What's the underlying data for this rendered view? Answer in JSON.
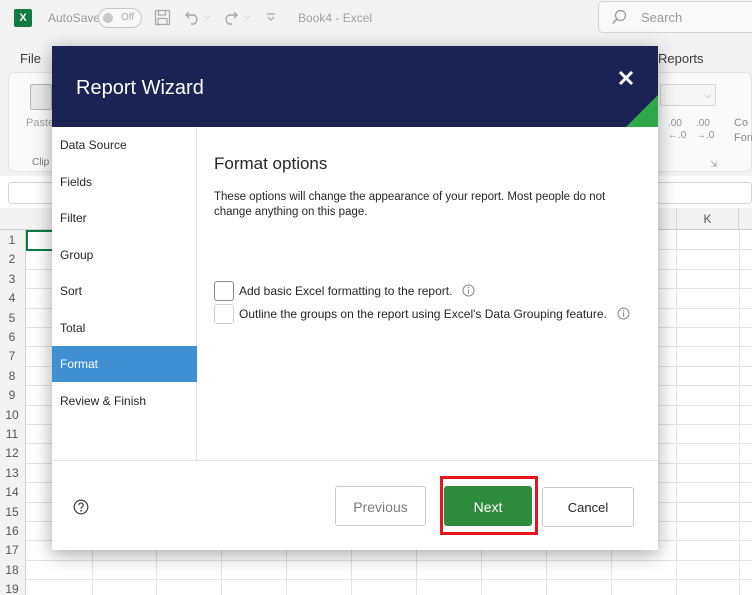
{
  "excel": {
    "logo_letter": "X",
    "autosave_label": "AutoSave",
    "autosave_state": "Off",
    "doc_title": "Book4  -  Excel",
    "search_placeholder": "Search",
    "menu": {
      "file": "File",
      "reports": "Reports"
    },
    "ribbon": {
      "paste_label": "Paste",
      "clipboard_label": "Clip",
      "increase_decimal": ".00",
      "decrease_decimal": ".00",
      "increase_decimal_sub": "←.0",
      "decrease_decimal_sub": "→.0",
      "cond_format_line1": "Co",
      "cond_format_line2": "Forr"
    },
    "grid": {
      "visible_column": "K",
      "rows": [
        "1",
        "2",
        "3",
        "4",
        "5",
        "6",
        "7",
        "8",
        "9",
        "10",
        "11",
        "12",
        "13",
        "14",
        "15",
        "16",
        "17",
        "18",
        "19"
      ]
    }
  },
  "dialog": {
    "title": "Report Wizard",
    "nav_items": [
      {
        "label": "Data Source",
        "active": false
      },
      {
        "label": "Fields",
        "active": false
      },
      {
        "label": "Filter",
        "active": false
      },
      {
        "label": "Group",
        "active": false
      },
      {
        "label": "Sort",
        "active": false
      },
      {
        "label": "Total",
        "active": false
      },
      {
        "label": "Format",
        "active": true
      },
      {
        "label": "Review & Finish",
        "active": false
      }
    ],
    "content": {
      "title": "Format options",
      "description": "These options will change the appearance of your report. Most people do not change anything on this page.",
      "options": [
        {
          "label": "Add basic Excel formatting to the report.",
          "checked": false
        },
        {
          "label": "Outline the groups on the report using Excel's Data Grouping feature.",
          "checked": false
        }
      ]
    },
    "footer": {
      "previous_label": "Previous",
      "next_label": "Next",
      "cancel_label": "Cancel"
    },
    "colors": {
      "header_bg": "#1b2355",
      "accent_green": "#2e8b3c",
      "nav_active": "#3f8fd2",
      "highlight_red": "#e8141c"
    }
  }
}
